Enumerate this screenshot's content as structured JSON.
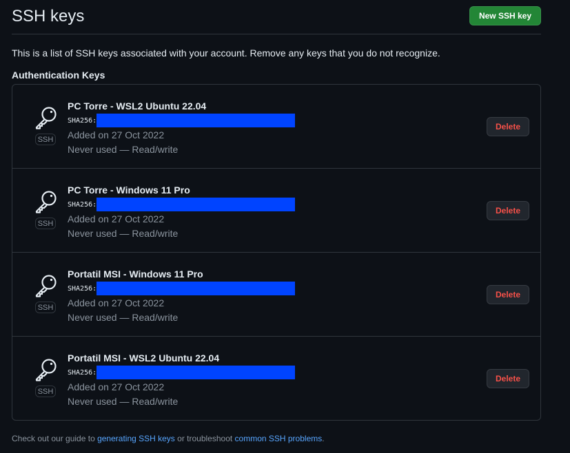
{
  "header": {
    "title": "SSH keys",
    "new_key_label": "New SSH key"
  },
  "intro": "This is a list of SSH keys associated with your account. Remove any keys that you do not recognize.",
  "section_title": "Authentication Keys",
  "keys": [
    {
      "title": "PC Torre - WSL2 Ubuntu 22.04",
      "fingerprint_label": "SHA256:",
      "added": "Added on 27 Oct 2022",
      "usage": "Never used — Read/write",
      "badge": "SSH",
      "delete_label": "Delete"
    },
    {
      "title": "PC Torre - Windows 11 Pro",
      "fingerprint_label": "SHA256:",
      "added": "Added on 27 Oct 2022",
      "usage": "Never used — Read/write",
      "badge": "SSH",
      "delete_label": "Delete"
    },
    {
      "title": "Portatil MSI - Windows 11 Pro",
      "fingerprint_label": "SHA256:",
      "added": "Added on 27 Oct 2022",
      "usage": "Never used — Read/write",
      "badge": "SSH",
      "delete_label": "Delete"
    },
    {
      "title": "Portatil MSI - WSL2 Ubuntu 22.04",
      "fingerprint_label": "SHA256:",
      "added": "Added on 27 Oct 2022",
      "usage": "Never used — Read/write",
      "badge": "SSH",
      "delete_label": "Delete"
    }
  ],
  "footer": {
    "prefix": "Check out our guide to ",
    "link1": "generating SSH keys",
    "middle": " or troubleshoot ",
    "link2": "common SSH problems",
    "suffix": "."
  },
  "icons": {
    "key": "key-icon"
  },
  "colors": {
    "background": "#0d1117",
    "primary_button": "#238636",
    "danger_text": "#f85149",
    "link": "#58a6ff",
    "redaction": "#0044ff"
  }
}
